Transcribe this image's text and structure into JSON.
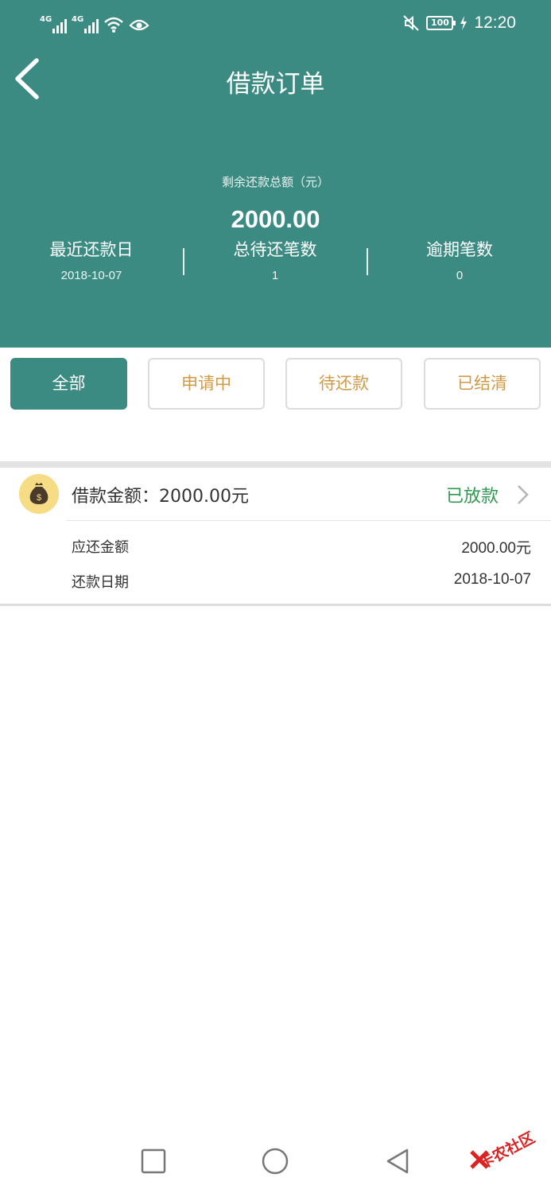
{
  "status_bar": {
    "signal1_label": "4G",
    "signal2_label": "4G",
    "battery": "100",
    "time": "12:20",
    "icons": [
      "signal-icon",
      "wifi-icon",
      "eye-icon",
      "mute-icon",
      "battery-icon",
      "charging-icon"
    ]
  },
  "header": {
    "title": "借款订单",
    "total_label": "剩余还款总额（元）",
    "total_amount": "2000.00",
    "stats": [
      {
        "label": "最近还款日",
        "value": "2018-10-07"
      },
      {
        "label": "总待还笔数",
        "value": "1"
      },
      {
        "label": "逾期笔数",
        "value": "0"
      }
    ]
  },
  "tabs": [
    {
      "label": "全部",
      "active": true
    },
    {
      "label": "申请中",
      "active": false
    },
    {
      "label": "待还款",
      "active": false
    },
    {
      "label": "已结清",
      "active": false
    }
  ],
  "order": {
    "title": "借款金额：2000.00元",
    "status": "已放款",
    "rows": [
      {
        "label": "应还金额",
        "value": "2000.00元"
      },
      {
        "label": "还款日期",
        "value": "2018-10-07"
      }
    ]
  },
  "watermark": {
    "text": "卡农社区"
  },
  "colors": {
    "primary": "#3b8b83",
    "tab_text": "#d19a48",
    "status_green": "#2e9a4f",
    "icon_bg": "#f6dc85"
  }
}
